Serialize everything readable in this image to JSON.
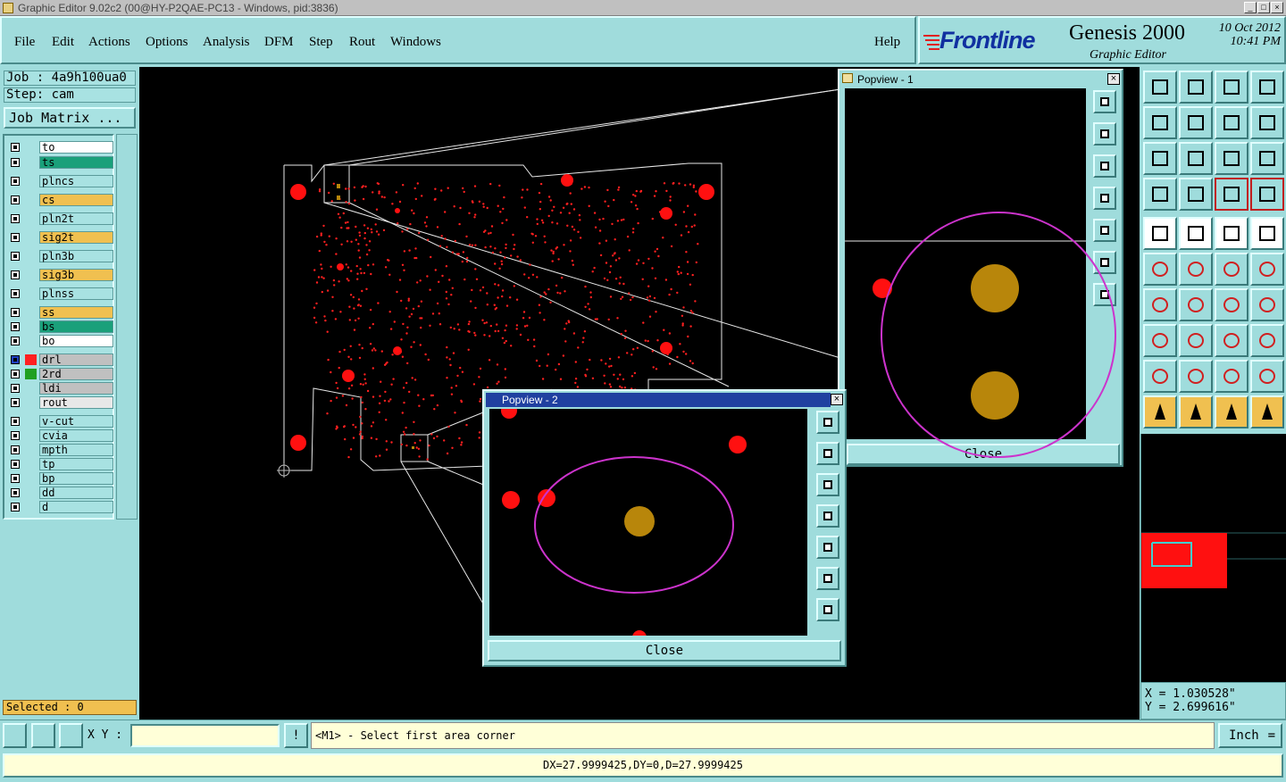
{
  "window": {
    "title": "Graphic Editor 9.02c2 (00@HY-P2QAE-PC13 - Windows, pid:3836)",
    "min": "_",
    "max": "□",
    "close": "×"
  },
  "menu": {
    "items": [
      "File",
      "Edit",
      "Actions",
      "Options",
      "Analysis",
      "DFM",
      "Step",
      "Rout",
      "Windows"
    ],
    "help": "Help"
  },
  "brand": {
    "logo": "Frontline",
    "product": "Genesis 2000",
    "subtitle": "Graphic Editor",
    "date": "10 Oct 2012",
    "time": "10:41 PM"
  },
  "job": {
    "job": "Job : 4a9h100ua0",
    "step": "Step: cam",
    "matrix_button": "Job Matrix ..."
  },
  "layers": [
    {
      "name": "to",
      "color": "#ffffff",
      "active": false
    },
    {
      "name": "ts",
      "color": "#1aa07a",
      "active": false
    },
    {
      "name": "plncs",
      "color": "#a8e2e2",
      "active": false
    },
    {
      "name": "cs",
      "color": "#f0c050",
      "active": false
    },
    {
      "name": "pln2t",
      "color": "#a8e2e2",
      "active": false
    },
    {
      "name": "sig2t",
      "color": "#f0c050",
      "active": false
    },
    {
      "name": "pln3b",
      "color": "#a8e2e2",
      "active": false
    },
    {
      "name": "sig3b",
      "color": "#f0c050",
      "active": false
    },
    {
      "name": "plnss",
      "color": "#a8e2e2",
      "active": false
    },
    {
      "name": "ss",
      "color": "#f0c050",
      "active": false
    },
    {
      "name": "bs",
      "color": "#1aa07a",
      "active": false
    },
    {
      "name": "bo",
      "color": "#ffffff",
      "active": false
    },
    {
      "name": "drl",
      "color": "#c0c0c0",
      "active": true,
      "swatch": "#ff2020"
    },
    {
      "name": "2rd",
      "color": "#c0c0c0",
      "active": false,
      "swatch": "#20a020"
    },
    {
      "name": "ldi",
      "color": "#c0c0c0",
      "active": false
    },
    {
      "name": "rout",
      "color": "#e8e8e8",
      "active": false
    },
    {
      "name": "v-cut",
      "color": "#a8e2e2",
      "active": false
    },
    {
      "name": "cvia",
      "color": "#a8e2e2",
      "active": false
    },
    {
      "name": "mpth",
      "color": "#a8e2e2",
      "active": false
    },
    {
      "name": "tp",
      "color": "#a8e2e2",
      "active": false
    },
    {
      "name": "bp",
      "color": "#a8e2e2",
      "active": false
    },
    {
      "name": "dd",
      "color": "#a8e2e2",
      "active": false
    },
    {
      "name": "d",
      "color": "#a8e2e2",
      "active": false
    }
  ],
  "selected": "Selected : 0",
  "popview1": {
    "title": "Popview - 1",
    "close": "Close"
  },
  "popview2": {
    "title": "Popview - 2",
    "close": "Close"
  },
  "coords": {
    "x": "X = 1.030528\"",
    "y": "Y = 2.699616\""
  },
  "bottom": {
    "xy_label": "X Y :",
    "xy_value": "",
    "message": "<M1> - Select first area corner",
    "unit": "Inch"
  },
  "status": "DX=27.9999425,DY=0,D=27.9999425",
  "colors": {
    "panel": "#9fdcdc",
    "canvas": "#000000",
    "pad": "#ff1010",
    "highlight": "#cc33cc",
    "copper": "#b8860b"
  }
}
